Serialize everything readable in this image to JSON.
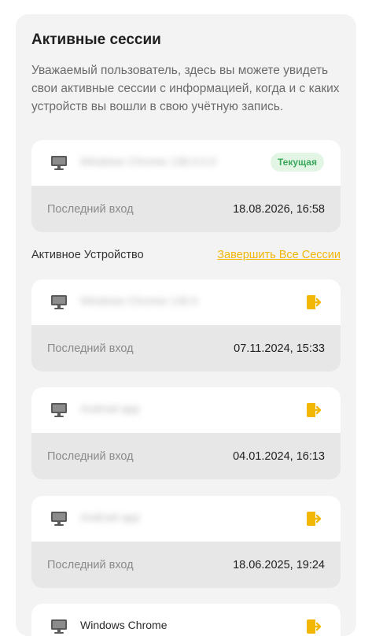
{
  "header": {
    "title": "Активные сессии",
    "description": "Уважаемый пользователь, здесь вы можете увидеть свои активные сессии с информацией, когда и с каких устройств вы вошли в свою учётную запись."
  },
  "current_session": {
    "device_name": "Windows Chrome 138.0.0.0",
    "badge": "Текущая",
    "last_login_label": "Последний вход",
    "last_login_value": "18.08.2026, 16:58"
  },
  "active_devices": {
    "section_label": "Активное Устройство",
    "end_all_label": "Завершить Все Сессии",
    "items": [
      {
        "device_name": "Windows Chrome 130.0",
        "last_login_label": "Последний вход",
        "last_login_value": "07.11.2024, 15:33"
      },
      {
        "device_name": "Android app",
        "last_login_label": "Последний вход",
        "last_login_value": "04.01.2024, 16:13"
      },
      {
        "device_name": "Android app",
        "last_login_label": "Последний вход",
        "last_login_value": "18.06.2025, 19:24"
      },
      {
        "device_name": "Windows Chrome"
      }
    ]
  },
  "colors": {
    "accent": "#f2b705",
    "current_badge_bg": "#e3f6e6",
    "current_badge_text": "#3aa85a"
  },
  "icons": {
    "device": "monitor-icon",
    "end_session": "logout-icon"
  }
}
